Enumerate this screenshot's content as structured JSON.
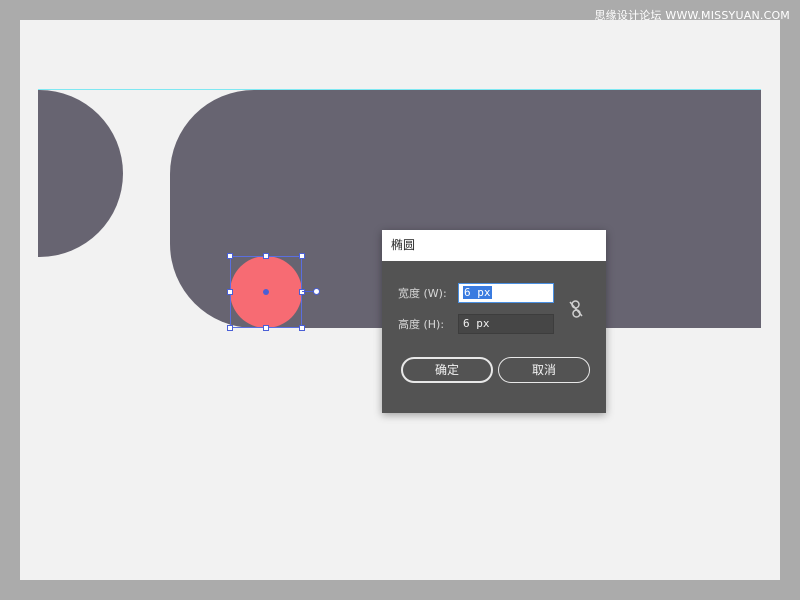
{
  "watermark": "思缘设计论坛 WWW.MISSYUAN.COM",
  "colors": {
    "canvas_bg": "#ababab",
    "artboard": "#f2f2f2",
    "shape_fill": "#676471",
    "ellipse_fill": "#f76b73",
    "selection": "#4a5fd6",
    "guide": "#7fe8f2",
    "dialog_bg": "#535353"
  },
  "dialog": {
    "title": "椭圆",
    "width_label": "宽度 (W):",
    "width_value": "6 px",
    "height_label": "高度 (H):",
    "height_value": "6 px",
    "constrain_icon": "unlinked-chain-icon",
    "ok_label": "确定",
    "cancel_label": "取消"
  }
}
